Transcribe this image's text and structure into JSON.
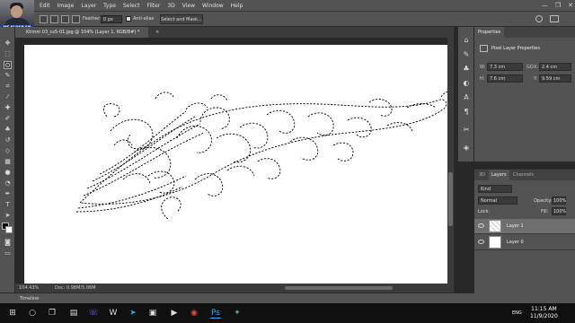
{
  "menubar": {
    "logo": "Ps",
    "items": [
      "Edit",
      "Image",
      "Layer",
      "Type",
      "Select",
      "Filter",
      "3D",
      "View",
      "Window",
      "Help"
    ],
    "window_controls": [
      "—",
      "❐",
      "✕"
    ]
  },
  "options": {
    "feather_label": "Feather:",
    "feather_value": "0 px",
    "antialias_label": "Anti-alias",
    "select_mask_label": "Select and Mask..."
  },
  "webcam": {
    "caption": "ME KLOCK SN"
  },
  "document": {
    "tab_title": "Khmm 03_cs5-01.jpg @ 104% (Layer 1, RGB/8#) *",
    "close": "×",
    "zoom": "104.43%",
    "doc_info": "Doc: 0.98M/5.06M"
  },
  "properties": {
    "tab": "Properties",
    "section": "Pixel Layer Properties",
    "w_label": "W:",
    "w_value": "7.3 cm",
    "h_label": "H:",
    "h_value": "7.6 cm",
    "go_label": "GO",
    "x_label": "X:",
    "x_value": "2.4 cm",
    "y_label": "Y:",
    "y_value": "9.59 cm"
  },
  "layers": {
    "tabs": [
      "3D",
      "Layers",
      "Channels"
    ],
    "kind": "Kind",
    "blend_mode": "Normal",
    "opacity_label": "Opacity:",
    "opacity_value": "100%",
    "lock_label": "Lock:",
    "fill_label": "Fill:",
    "fill_value": "100%",
    "items": [
      {
        "name": "Layer 1",
        "selected": true
      },
      {
        "name": "Layer 0",
        "selected": false
      }
    ]
  },
  "timeline": {
    "label": "Timeline"
  },
  "taskbar": {
    "time": "11:15 AM",
    "date": "11/9/2020",
    "language": "ENG"
  },
  "colors": {
    "panel": "#535353",
    "dark": "#282828",
    "accent": "#31a8ff",
    "selection": "#000000"
  }
}
